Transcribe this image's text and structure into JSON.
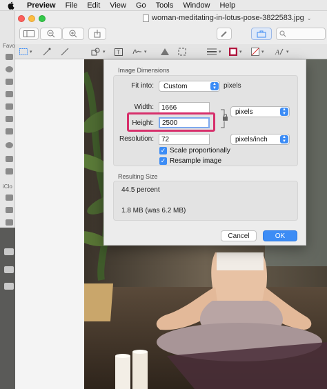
{
  "menubar": {
    "app_name": "Preview",
    "items": [
      "File",
      "Edit",
      "View",
      "Go",
      "Tools",
      "Window",
      "Help"
    ]
  },
  "background_window": {
    "labels": [
      "Favo",
      "iClo"
    ]
  },
  "window": {
    "title": "woman-meditating-in-lotus-pose-3822583.jpg"
  },
  "dialog": {
    "section_dimensions": "Image Dimensions",
    "fit_into_label": "Fit into:",
    "fit_into_value": "Custom",
    "fit_into_unit": "pixels",
    "width_label": "Width:",
    "width_value": "1666",
    "height_label": "Height:",
    "height_value": "2500",
    "size_unit": "pixels",
    "resolution_label": "Resolution:",
    "resolution_value": "72",
    "resolution_unit": "pixels/inch",
    "scale_label": "Scale proportionally",
    "resample_label": "Resample image",
    "section_result": "Resulting Size",
    "percent_text": "44.5 percent",
    "size_text": "1.8 MB (was 6.2 MB)",
    "cancel_label": "Cancel",
    "ok_label": "OK"
  },
  "colors": {
    "accent": "#3c8cf5",
    "highlight": "#d72f6b"
  }
}
